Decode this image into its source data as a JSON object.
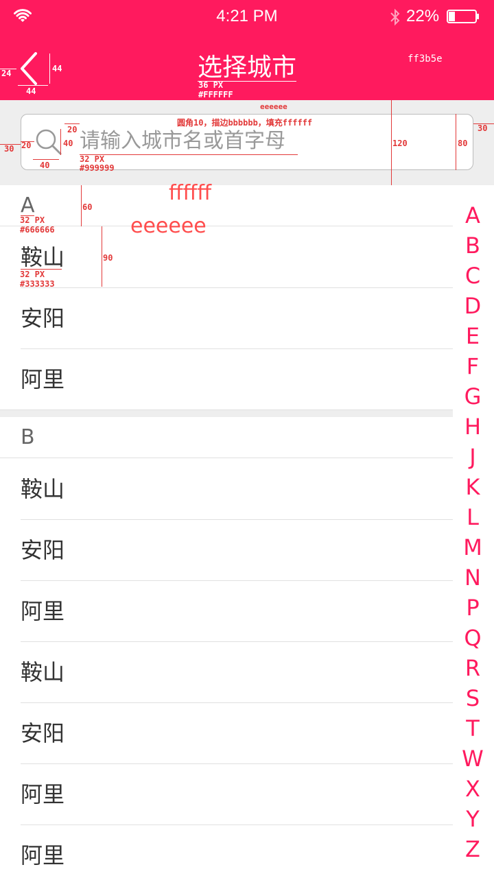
{
  "status_bar": {
    "time": "4:21 PM",
    "battery": "22%"
  },
  "header": {
    "title": "选择城市",
    "background_color": "#ff1a5e",
    "color_note": "ff3b5e",
    "title_note_size": "36 PX",
    "title_note_color": "#FFFFFF"
  },
  "search": {
    "placeholder": "请输入城市名或首字母",
    "note_size": "32 PX",
    "note_color": "#999999",
    "border_note": "圆角10，描边bbbbbb，填充ffffff",
    "bg_note": "eeeeee"
  },
  "sections": [
    {
      "letter": "A",
      "note_size": "32 PX",
      "note_color": "#666666",
      "cities": [
        "鞍山",
        "安阳",
        "阿里"
      ]
    },
    {
      "letter": "B",
      "cities": [
        "鞍山",
        "安阳",
        "阿里",
        "鞍山",
        "安阳",
        "阿里",
        "阿里"
      ]
    }
  ],
  "city_note_size": "32 PX",
  "city_note_color": "#333333",
  "list_bg_note": "ffffff",
  "divider_note": "eeeeee",
  "index_letters": [
    "A",
    "B",
    "C",
    "D",
    "E",
    "F",
    "G",
    "H",
    "J",
    "K",
    "L",
    "M",
    "N",
    "P",
    "Q",
    "R",
    "S",
    "T",
    "W",
    "X",
    "Y",
    "Z"
  ],
  "dimension_notes": {
    "back_left": "24",
    "back_height": "44",
    "back_width": "44",
    "search_top": "20",
    "search_icon": "40",
    "search_left": "30",
    "icon_left": "20",
    "icon_width": "40",
    "search_height": "80",
    "search_right": "30",
    "zone_height": "120",
    "header_height": "60",
    "row_height": "90"
  }
}
